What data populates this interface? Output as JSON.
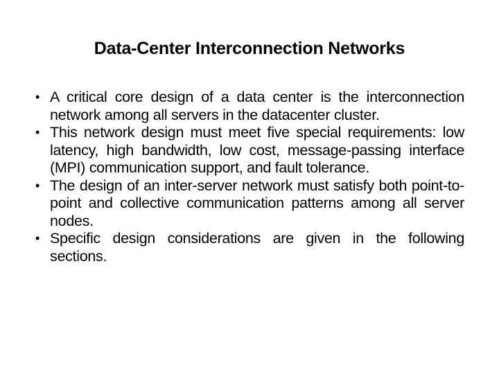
{
  "slide": {
    "title": "Data-Center Interconnection Networks",
    "bullets": [
      {
        "marker": "•",
        "text": "A critical core design of a data center is the interconnection network among all servers in the datacenter cluster."
      },
      {
        "marker": "•",
        "text": "This network design must meet five special requirements: low latency, high bandwidth, low cost, message-passing interface (MPI) communication support, and fault tolerance."
      },
      {
        "marker": "•",
        "text": "The design of an inter-server network must satisfy both point-to-point and collective communication patterns among all server nodes."
      },
      {
        "marker": "•",
        "text": "Specific design considerations are given in the following sections."
      }
    ]
  }
}
